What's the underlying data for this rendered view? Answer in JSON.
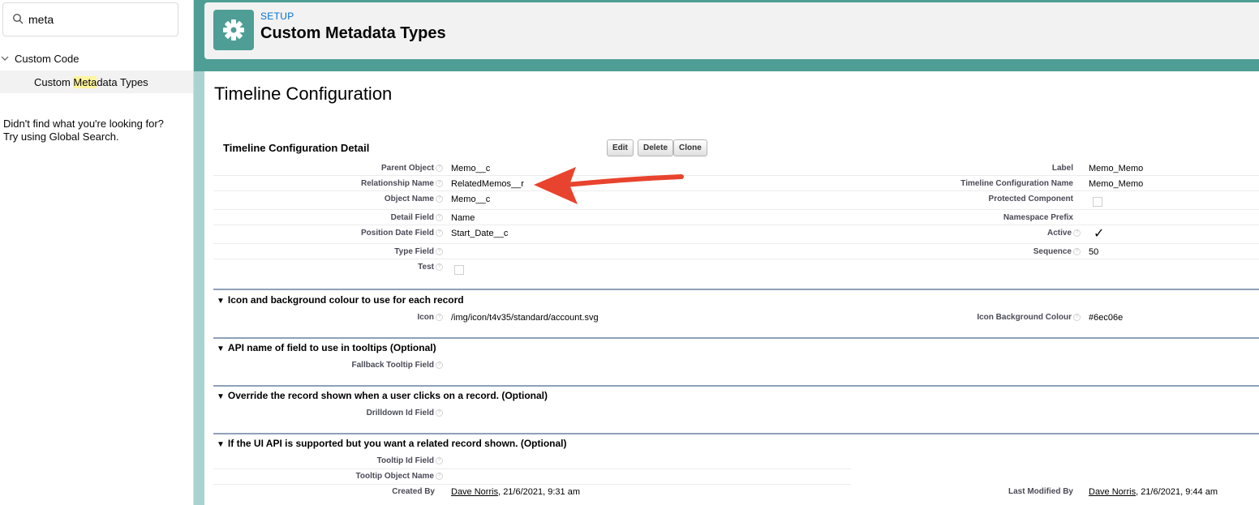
{
  "sidebar": {
    "search_value": "meta",
    "tree_parent": "Custom Code",
    "child_pre": "Custom ",
    "child_highlight": "Meta",
    "child_post": "data Types",
    "not_found_line1": "Didn't find what you're looking for?",
    "not_found_line2": "Try using Global Search."
  },
  "header": {
    "eyebrow": "SETUP",
    "title": "Custom Metadata Types",
    "icon": "gear-icon"
  },
  "page": {
    "title": "Timeline Configuration",
    "block_title": "Timeline Configuration Detail",
    "buttons": {
      "edit": "Edit",
      "delete": "Delete",
      "clone": "Clone"
    }
  },
  "detail": {
    "parent_object_label": "Parent Object",
    "parent_object_value": "Memo__c",
    "relationship_name_label": "Relationship Name",
    "relationship_name_value": "RelatedMemos__r",
    "object_name_label": "Object Name",
    "object_name_value": "Memo__c",
    "detail_field_label": "Detail Field",
    "detail_field_value": "Name",
    "position_date_label": "Position Date Field",
    "position_date_value": "Start_Date__c",
    "type_field_label": "Type Field",
    "test_label": "Test",
    "label_label": "Label",
    "label_value": "Memo_Memo",
    "tc_name_label": "Timeline Configuration Name",
    "tc_name_value": "Memo_Memo",
    "protected_label": "Protected Component",
    "namespace_label": "Namespace Prefix",
    "active_label": "Active",
    "active_mark": "✓",
    "sequence_label": "Sequence",
    "sequence_value": "50"
  },
  "sections": {
    "icon_section": {
      "title": "Icon and background colour to use for each record",
      "icon_label": "Icon",
      "icon_value": "/img/icon/t4v35/standard/account.svg",
      "icon_bg_label": "Icon Background Colour",
      "icon_bg_value": "#6ec06e"
    },
    "tooltip_section": {
      "title": "API name of field to use in tooltips (Optional)",
      "fallback_label": "Fallback Tooltip Field"
    },
    "override_section": {
      "title": "Override the record shown when a user clicks on a record. (Optional)",
      "drilldown_label": "Drilldown Id Field"
    },
    "uiapi_section": {
      "title": "If the UI API is supported but you want a related record shown. (Optional)",
      "tooltip_id_label": "Tooltip Id Field",
      "tooltip_object_label": "Tooltip Object Name"
    }
  },
  "audit": {
    "created_by_label": "Created By",
    "created_by_user": "Dave Norris",
    "created_by_date": ", 21/6/2021, 9:31 am",
    "modified_by_label": "Last Modified By",
    "modified_by_user": "Dave Norris",
    "modified_by_date": ", 21/6/2021, 9:44 am"
  },
  "colors": {
    "brand_teal": "#4f9e95",
    "light_teal": "#a9d3d0",
    "annotation_arrow": "#e8432e",
    "link_blue": "#0070d2"
  },
  "help_glyph": "?"
}
